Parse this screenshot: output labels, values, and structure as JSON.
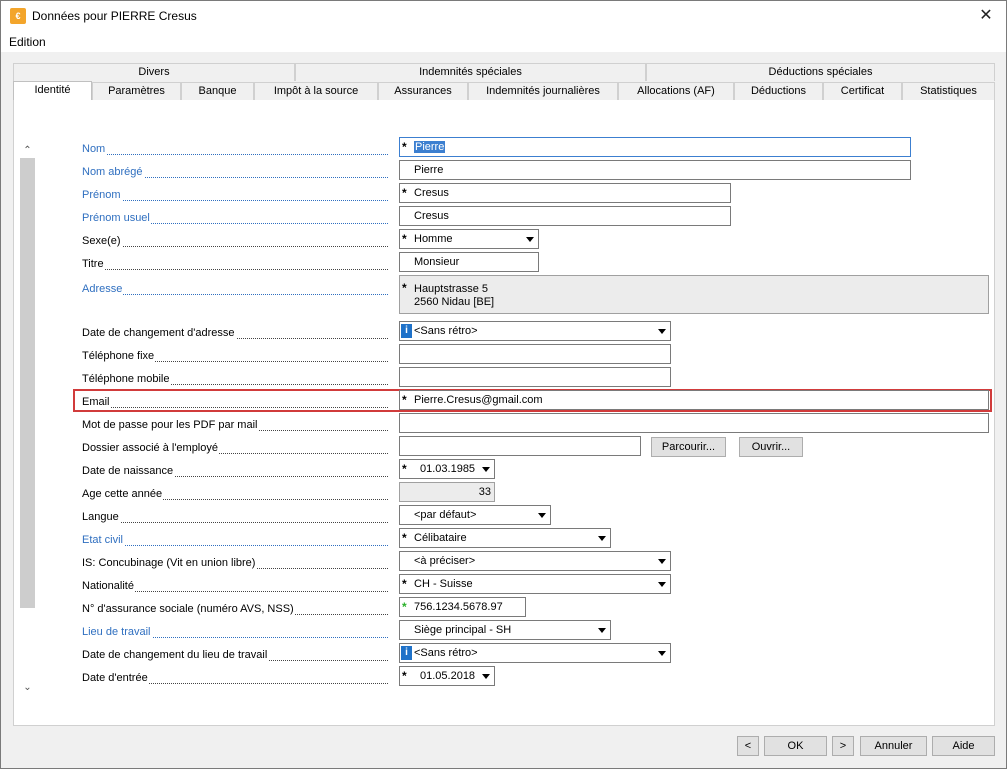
{
  "window": {
    "title": "Données pour PIERRE Cresus",
    "app_icon": "cresus-icon",
    "close": "✕"
  },
  "menu": {
    "edition": "Edition"
  },
  "tabs_row1": [
    "Divers",
    "Indemnités spéciales",
    "Déductions spéciales"
  ],
  "tabs_row2": [
    "Identité",
    "Paramètres",
    "Banque",
    "Impôt à la source",
    "Assurances",
    "Indemnités journalières",
    "Allocations (AF)",
    "Déductions",
    "Certificat",
    "Statistiques"
  ],
  "fields": {
    "nom": {
      "label": "Nom",
      "value": "Pierre"
    },
    "nom_abrege": {
      "label": "Nom abrégé",
      "value": "Pierre"
    },
    "prenom": {
      "label": "Prénom",
      "value": "Cresus"
    },
    "prenom_usuel": {
      "label": "Prénom usuel",
      "value": "Cresus"
    },
    "sexe": {
      "label": "Sexe(e)",
      "value": "Homme"
    },
    "titre": {
      "label": "Titre",
      "value": "Monsieur"
    },
    "adresse": {
      "label": "Adresse",
      "line1": "Hauptstrasse 5",
      "line2": "2560 Nidau [BE]"
    },
    "date_chg_adresse": {
      "label": "Date de changement d'adresse",
      "value": "<Sans rétro>"
    },
    "tel_fixe": {
      "label": "Téléphone fixe",
      "value": ""
    },
    "tel_mobile": {
      "label": "Téléphone mobile",
      "value": ""
    },
    "email": {
      "label": "Email",
      "value": "Pierre.Cresus@gmail.com"
    },
    "mdp_pdf": {
      "label": "Mot de passe pour les PDF par mail",
      "value": ""
    },
    "dossier": {
      "label": "Dossier associé à l'employé",
      "value": "",
      "browse": "Parcourir...",
      "open": "Ouvrir..."
    },
    "naissance": {
      "label": "Date de naissance",
      "value": "01.03.1985"
    },
    "age": {
      "label": "Age cette année",
      "value": "33"
    },
    "langue": {
      "label": "Langue",
      "value": "<par défaut>"
    },
    "etat_civil": {
      "label": "Etat civil",
      "value": "Célibataire"
    },
    "concubinage": {
      "label": "IS: Concubinage (Vit en union libre)",
      "value": "<à préciser>"
    },
    "nationalite": {
      "label": "Nationalité",
      "value": "CH - Suisse"
    },
    "avs": {
      "label": "N° d'assurance sociale (numéro AVS, NSS)",
      "value": "756.1234.5678.97"
    },
    "lieu_travail": {
      "label": "Lieu de travail",
      "value": "Siège principal - SH"
    },
    "date_chg_lieu": {
      "label": "Date de changement du lieu de travail",
      "value": "<Sans rétro>"
    },
    "date_entree": {
      "label": "Date d'entrée",
      "value": "01.05.2018"
    }
  },
  "buttons": {
    "prev": "<",
    "ok": "OK",
    "next": ">",
    "cancel": "Annuler",
    "help": "Aide"
  },
  "colors": {
    "link_label": "#2f6fc0",
    "highlight": "#d13b3b",
    "required_green": "#2bb12b"
  }
}
